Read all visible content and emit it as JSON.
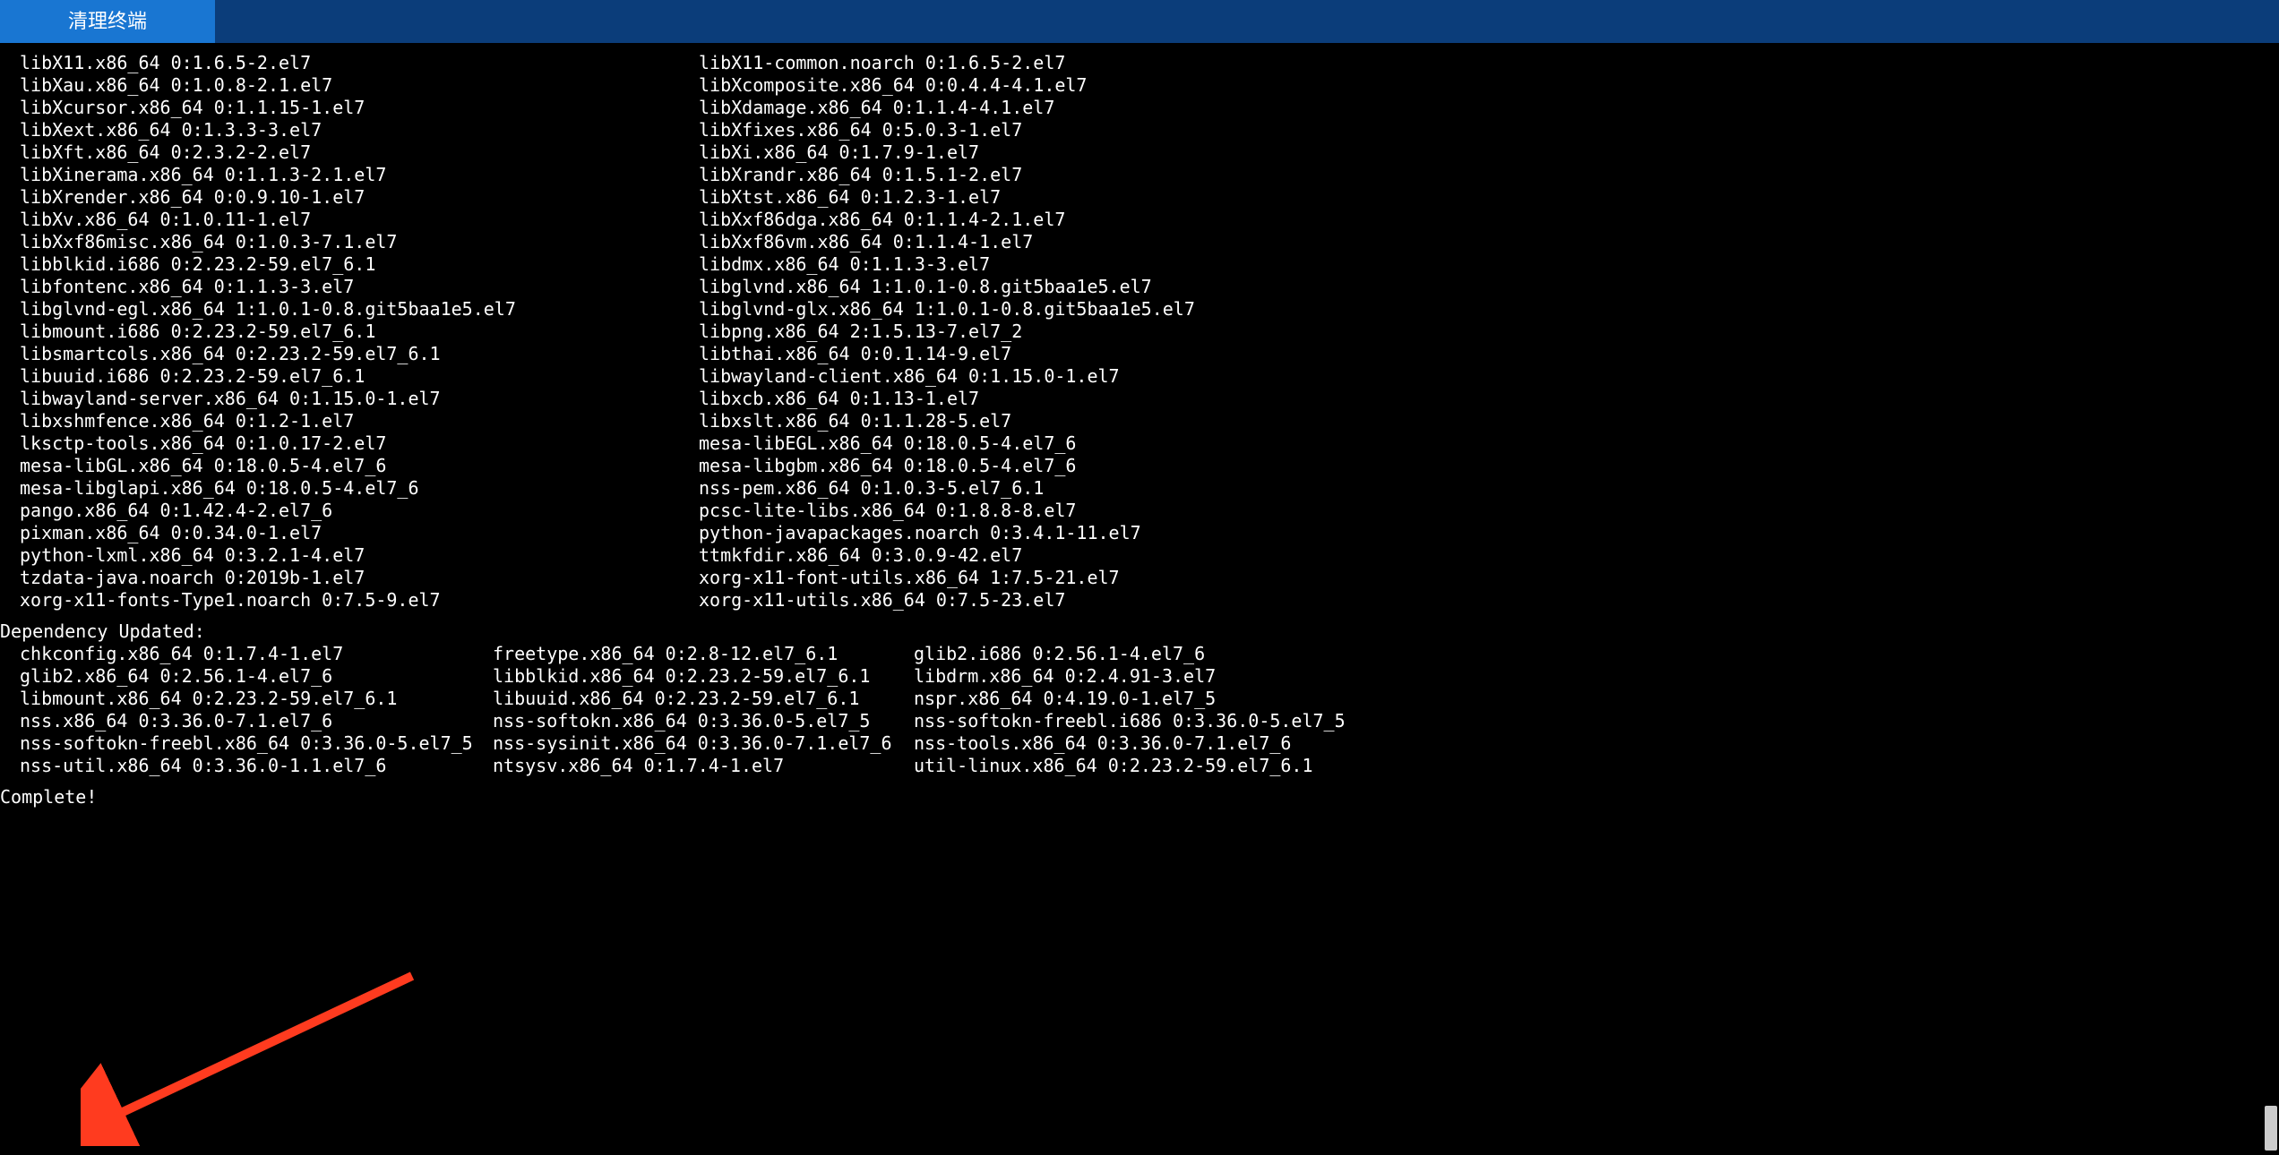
{
  "header": {
    "clear_button_label": "清理终端"
  },
  "packages_two_col": {
    "left": [
      "libX11.x86_64 0:1.6.5-2.el7",
      "libXau.x86_64 0:1.0.8-2.1.el7",
      "libXcursor.x86_64 0:1.1.15-1.el7",
      "libXext.x86_64 0:1.3.3-3.el7",
      "libXft.x86_64 0:2.3.2-2.el7",
      "libXinerama.x86_64 0:1.1.3-2.1.el7",
      "libXrender.x86_64 0:0.9.10-1.el7",
      "libXv.x86_64 0:1.0.11-1.el7",
      "libXxf86misc.x86_64 0:1.0.3-7.1.el7",
      "libblkid.i686 0:2.23.2-59.el7_6.1",
      "libfontenc.x86_64 0:1.1.3-3.el7",
      "libglvnd-egl.x86_64 1:1.0.1-0.8.git5baa1e5.el7",
      "libmount.i686 0:2.23.2-59.el7_6.1",
      "libsmartcols.x86_64 0:2.23.2-59.el7_6.1",
      "libuuid.i686 0:2.23.2-59.el7_6.1",
      "libwayland-server.x86_64 0:1.15.0-1.el7",
      "libxshmfence.x86_64 0:1.2-1.el7",
      "lksctp-tools.x86_64 0:1.0.17-2.el7",
      "mesa-libGL.x86_64 0:18.0.5-4.el7_6",
      "mesa-libglapi.x86_64 0:18.0.5-4.el7_6",
      "pango.x86_64 0:1.42.4-2.el7_6",
      "pixman.x86_64 0:0.34.0-1.el7",
      "python-lxml.x86_64 0:3.2.1-4.el7",
      "tzdata-java.noarch 0:2019b-1.el7",
      "xorg-x11-fonts-Type1.noarch 0:7.5-9.el7"
    ],
    "right": [
      "libX11-common.noarch 0:1.6.5-2.el7",
      "libXcomposite.x86_64 0:0.4.4-4.1.el7",
      "libXdamage.x86_64 0:1.1.4-4.1.el7",
      "libXfixes.x86_64 0:5.0.3-1.el7",
      "libXi.x86_64 0:1.7.9-1.el7",
      "libXrandr.x86_64 0:1.5.1-2.el7",
      "libXtst.x86_64 0:1.2.3-1.el7",
      "libXxf86dga.x86_64 0:1.1.4-2.1.el7",
      "libXxf86vm.x86_64 0:1.1.4-1.el7",
      "libdmx.x86_64 0:1.1.3-3.el7",
      "libglvnd.x86_64 1:1.0.1-0.8.git5baa1e5.el7",
      "libglvnd-glx.x86_64 1:1.0.1-0.8.git5baa1e5.el7",
      "libpng.x86_64 2:1.5.13-7.el7_2",
      "libthai.x86_64 0:0.1.14-9.el7",
      "libwayland-client.x86_64 0:1.15.0-1.el7",
      "libxcb.x86_64 0:1.13-1.el7",
      "libxslt.x86_64 0:1.1.28-5.el7",
      "mesa-libEGL.x86_64 0:18.0.5-4.el7_6",
      "mesa-libgbm.x86_64 0:18.0.5-4.el7_6",
      "nss-pem.x86_64 0:1.0.3-5.el7_6.1",
      "pcsc-lite-libs.x86_64 0:1.8.8-8.el7",
      "python-javapackages.noarch 0:3.4.1-11.el7",
      "ttmkfdir.x86_64 0:3.0.9-42.el7",
      "xorg-x11-font-utils.x86_64 1:7.5-21.el7",
      "xorg-x11-utils.x86_64 0:7.5-23.el7"
    ]
  },
  "dependency_updated": {
    "header": "Dependency Updated:",
    "col_a": [
      "chkconfig.x86_64 0:1.7.4-1.el7",
      "glib2.x86_64 0:2.56.1-4.el7_6",
      "libmount.x86_64 0:2.23.2-59.el7_6.1",
      "nss.x86_64 0:3.36.0-7.1.el7_6",
      "nss-softokn-freebl.x86_64 0:3.36.0-5.el7_5",
      "nss-util.x86_64 0:3.36.0-1.1.el7_6"
    ],
    "col_b": [
      "freetype.x86_64 0:2.8-12.el7_6.1",
      "libblkid.x86_64 0:2.23.2-59.el7_6.1",
      "libuuid.x86_64 0:2.23.2-59.el7_6.1",
      "nss-softokn.x86_64 0:3.36.0-5.el7_5",
      "nss-sysinit.x86_64 0:3.36.0-7.1.el7_6",
      "ntsysv.x86_64 0:1.7.4-1.el7"
    ],
    "col_c": [
      "glib2.i686 0:2.56.1-4.el7_6",
      "libdrm.x86_64 0:2.4.91-3.el7",
      "nspr.x86_64 0:4.19.0-1.el7_5",
      "nss-softokn-freebl.i686 0:3.36.0-5.el7_5",
      "nss-tools.x86_64 0:3.36.0-7.1.el7_6",
      "util-linux.x86_64 0:2.23.2-59.el7_6.1"
    ]
  },
  "complete_line": "Complete!"
}
